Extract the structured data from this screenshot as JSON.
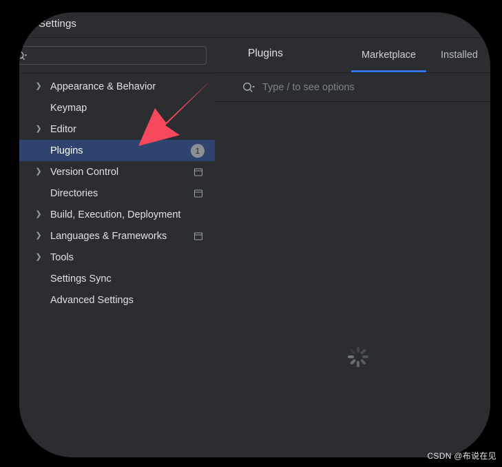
{
  "window": {
    "title": "Settings"
  },
  "sidebar": {
    "search": {
      "value": "",
      "placeholder": "",
      "icon": "search-icon"
    },
    "items": [
      {
        "label": "Appearance & Behavior",
        "expandable": true,
        "selected": false,
        "badge": null,
        "scope_icon": false
      },
      {
        "label": "Keymap",
        "expandable": false,
        "selected": false,
        "badge": null,
        "scope_icon": false
      },
      {
        "label": "Editor",
        "expandable": true,
        "selected": false,
        "badge": null,
        "scope_icon": false
      },
      {
        "label": "Plugins",
        "expandable": false,
        "selected": true,
        "badge": "1",
        "scope_icon": false
      },
      {
        "label": "Version Control",
        "expandable": true,
        "selected": false,
        "badge": null,
        "scope_icon": true
      },
      {
        "label": "Directories",
        "expandable": false,
        "selected": false,
        "badge": null,
        "scope_icon": true
      },
      {
        "label": "Build, Execution, Deployment",
        "expandable": true,
        "selected": false,
        "badge": null,
        "scope_icon": false
      },
      {
        "label": "Languages & Frameworks",
        "expandable": true,
        "selected": false,
        "badge": null,
        "scope_icon": true
      },
      {
        "label": "Tools",
        "expandable": true,
        "selected": false,
        "badge": null,
        "scope_icon": false
      },
      {
        "label": "Settings Sync",
        "expandable": false,
        "selected": false,
        "badge": null,
        "scope_icon": false
      },
      {
        "label": "Advanced Settings",
        "expandable": false,
        "selected": false,
        "badge": null,
        "scope_icon": false
      }
    ]
  },
  "main": {
    "title": "Plugins",
    "tabs": [
      {
        "label": "Marketplace",
        "active": true
      },
      {
        "label": "Installed",
        "active": false
      }
    ],
    "search": {
      "value": "",
      "placeholder": "Type / to see options",
      "icon": "search-icon"
    },
    "loading": {
      "icon": "loading-spinner-icon"
    }
  },
  "annotation": {
    "arrow": {
      "icon": "red-arrow-icon",
      "color": "#f8485e",
      "points_to": "Plugins"
    }
  },
  "watermark": {
    "text": "CSDN @布说在见"
  },
  "colors": {
    "window_background": "#2b2d30",
    "outside_background": "#000000",
    "selection": "#2e436e",
    "accent": "#3574f0",
    "text_primary": "#dfe1e5",
    "text_muted": "#868a91",
    "divider": "#1f2022",
    "badge_background": "#8b8f96",
    "arrow_red": "#f8485e"
  }
}
